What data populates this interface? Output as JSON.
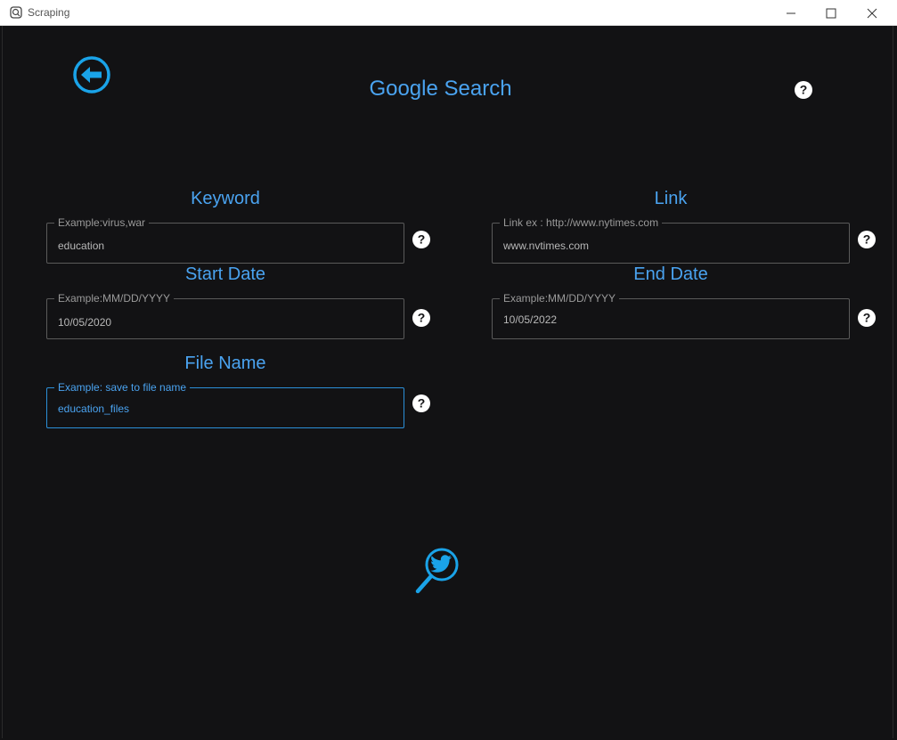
{
  "window": {
    "title": "Scraping"
  },
  "header": {
    "title": "Google Search"
  },
  "fields": {
    "keyword": {
      "label": "Keyword",
      "placeholder": "Example:virus,war",
      "value": "education"
    },
    "link": {
      "label": "Link",
      "placeholder": "Link ex : http://www.nytimes.com",
      "value": "www.nvtimes.com"
    },
    "start_date": {
      "label": "Start Date",
      "placeholder": "Example:MM/DD/YYYY",
      "value": "10/05/2020"
    },
    "end_date": {
      "label": "End Date",
      "placeholder": "Example:MM/DD/YYYY",
      "value": "10/05/2022"
    },
    "file_name": {
      "label": "File Name",
      "placeholder": "Example: save to file name",
      "value": "education_files"
    }
  },
  "icons": {
    "back": "back-arrow-icon",
    "help": "help-circle-icon",
    "search": "twitter-search-icon"
  },
  "colors": {
    "accent": "#4aa3f0",
    "background": "#121214",
    "border": "#5a5a5a",
    "active_border": "#2b8fd8"
  }
}
